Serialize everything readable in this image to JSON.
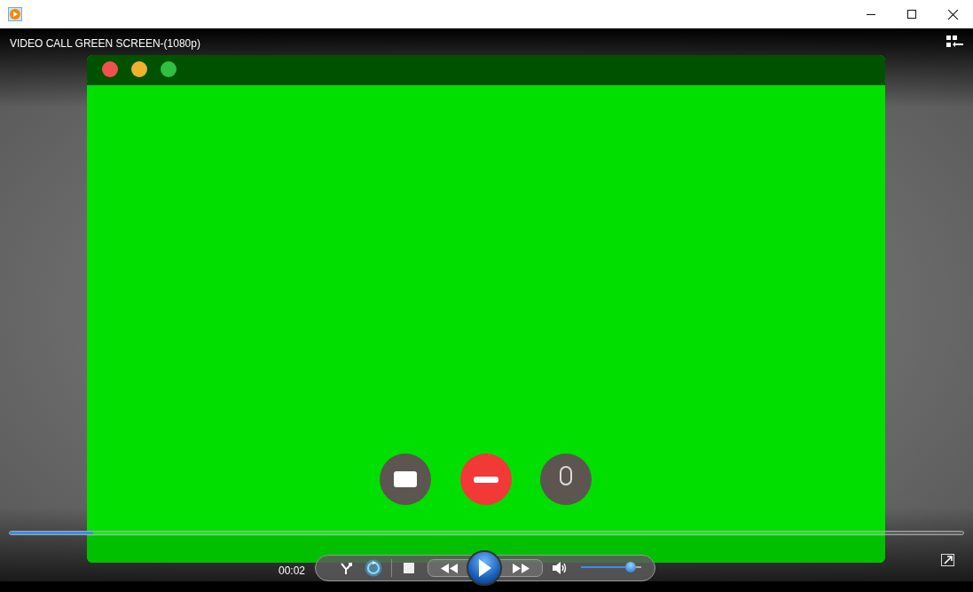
{
  "player": {
    "title": "VIDEO CALL GREEN SCREEN-(1080p)"
  },
  "seek": {
    "level": 0.087
  },
  "controls": {
    "elapsed": "00:02",
    "shuffle_on": false,
    "repeat_on": true,
    "volume": {
      "level": 0.82
    }
  }
}
